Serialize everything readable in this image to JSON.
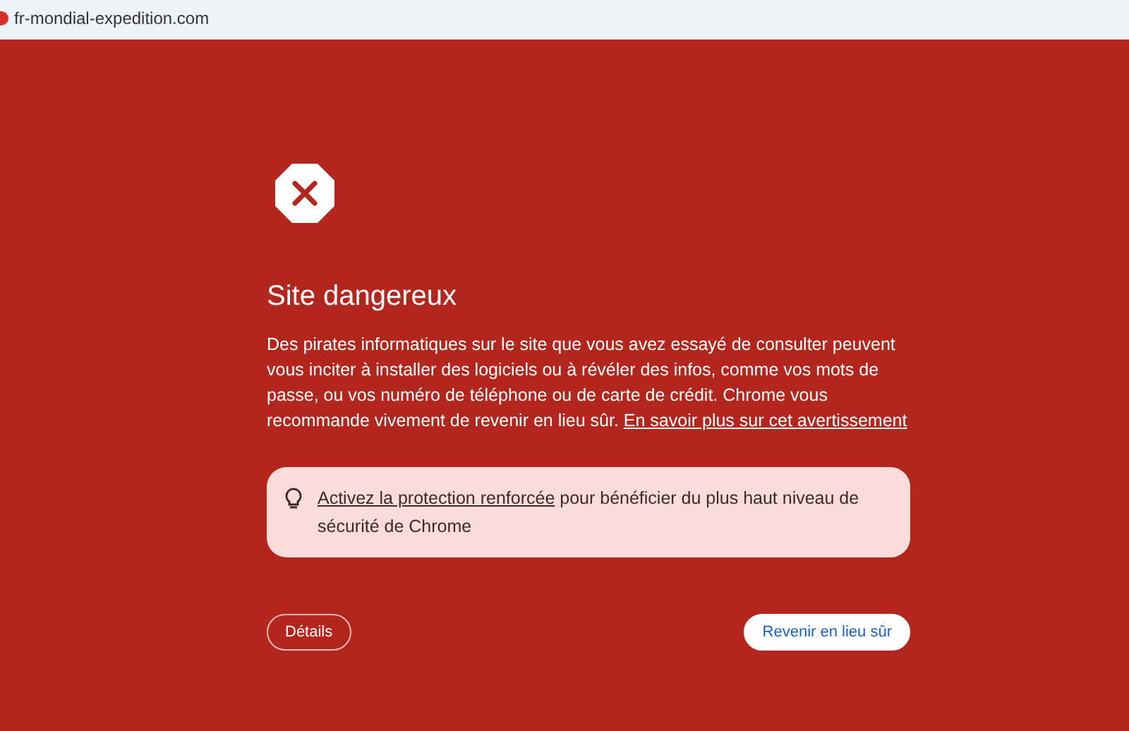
{
  "address_bar": {
    "url": "fr-mondial-expedition.com"
  },
  "warning": {
    "title": "Site dangereux",
    "body": "Des pirates informatiques sur le site que vous avez essayé de consulter peuvent vous inciter à installer des logiciels ou à révéler des infos, comme vos mots de passe, ou vos numéro de téléphone ou de carte de crédit. Chrome vous recommande vivement de revenir en lieu sûr.",
    "learn_more_link": "En savoir plus sur cet avertissement"
  },
  "tip": {
    "link": "Activez la protection renforcée",
    "text": "pour bénéficier du plus haut niveau de sécurité de Chrome"
  },
  "buttons": [
    {
      "kind": "outline",
      "label": "Détails"
    },
    {
      "kind": "filled",
      "label": "Revenir en lieu sûr"
    }
  ]
}
